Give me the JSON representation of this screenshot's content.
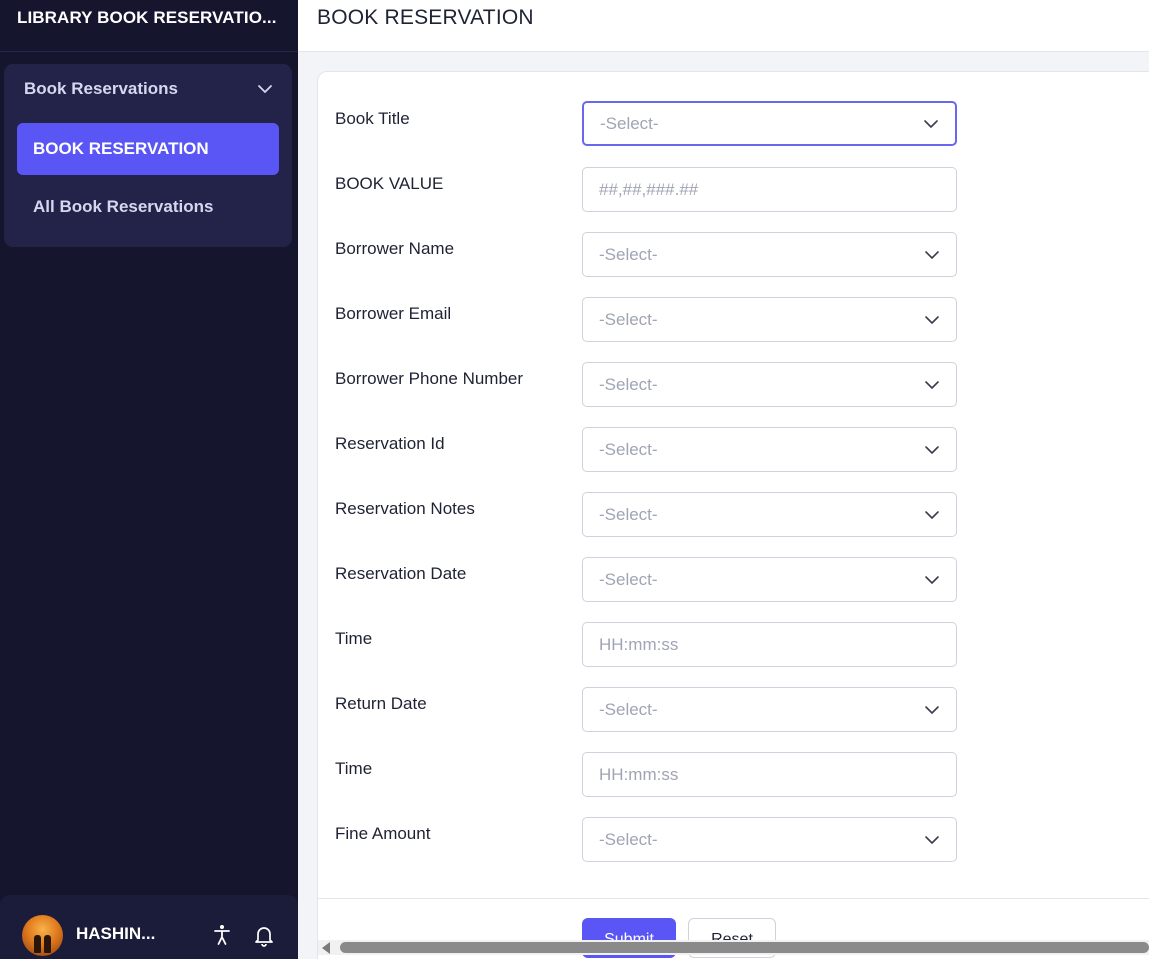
{
  "app": {
    "title": "LIBRARY BOOK RESERVATIO..."
  },
  "sidebar": {
    "group_label": "Book Reservations",
    "items": [
      {
        "label": "BOOK RESERVATION",
        "active": true
      },
      {
        "label": "All Book Reservations",
        "active": false
      }
    ],
    "user_name": "HASHIN..."
  },
  "header": {
    "title": "BOOK RESERVATION"
  },
  "form": {
    "fields": [
      {
        "label": "Book Title",
        "placeholder": "-Select-",
        "type": "select"
      },
      {
        "label": "BOOK VALUE",
        "placeholder": "##,##,###.##",
        "type": "input"
      },
      {
        "label": "Borrower Name",
        "placeholder": "-Select-",
        "type": "select"
      },
      {
        "label": "Borrower Email",
        "placeholder": "-Select-",
        "type": "select"
      },
      {
        "label": "Borrower Phone Number",
        "placeholder": "-Select-",
        "type": "select"
      },
      {
        "label": "Reservation Id",
        "placeholder": "-Select-",
        "type": "select"
      },
      {
        "label": "Reservation Notes",
        "placeholder": "-Select-",
        "type": "select"
      },
      {
        "label": "Reservation Date",
        "placeholder": "-Select-",
        "type": "select"
      },
      {
        "label": "Time",
        "placeholder": "HH:mm:ss",
        "type": "input"
      },
      {
        "label": "Return Date",
        "placeholder": "-Select-",
        "type": "select"
      },
      {
        "label": "Time",
        "placeholder": "HH:mm:ss",
        "type": "input"
      },
      {
        "label": "Fine Amount",
        "placeholder": "-Select-",
        "type": "select"
      }
    ],
    "submit_label": "Submit",
    "reset_label": "Reset"
  },
  "colors": {
    "sidebar_bg": "#15152e",
    "accent": "#5a55f5",
    "group_bg": "#23234a"
  },
  "icons": [
    "chevron-down-icon",
    "accessibility-icon",
    "bell-icon"
  ]
}
